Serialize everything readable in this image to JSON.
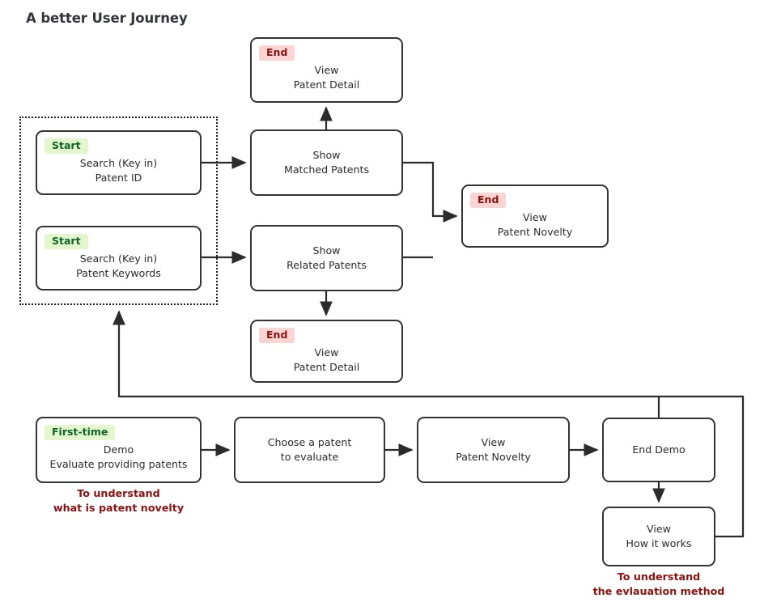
{
  "title": "A better User Journey",
  "colors": {
    "start_badge_bg": "#e4f7cc",
    "start_badge_text": "#10632c",
    "end_badge_bg": "#fbd4d4",
    "end_badge_text": "#8c1111",
    "node_border": "#333333",
    "caption_text": "#8c1111",
    "title_text": "#33353a",
    "edge": "#2b2b2b"
  },
  "badges": {
    "start": "Start",
    "end": "End",
    "first_time": "First-time"
  },
  "nodes": {
    "view_patent_detail_top": {
      "badge": "End",
      "label": "View\nPatent Detail"
    },
    "search_patent_id": {
      "badge": "Start",
      "label": "Search (Key in)\nPatent ID"
    },
    "search_patent_keywords": {
      "badge": "Start",
      "label": "Search (Key in)\nPatent Keywords"
    },
    "show_matched_patents": {
      "badge": "",
      "label": "Show\nMatched Patents"
    },
    "show_related_patents": {
      "badge": "",
      "label": "Show\nRelated Patents"
    },
    "view_patent_novelty_right": {
      "badge": "End",
      "label": "View\nPatent Novelty"
    },
    "view_patent_detail_bottom": {
      "badge": "End",
      "label": "View\nPatent Detail"
    },
    "demo_evaluate": {
      "badge": "First-time",
      "label": "Demo\nEvaluate providing patents"
    },
    "choose_a_patent": {
      "badge": "",
      "label": "Choose a patent\nto evaluate"
    },
    "view_patent_novelty_demo": {
      "badge": "",
      "label": "View\nPatent Novelty"
    },
    "end_demo": {
      "badge": "",
      "label": "End Demo"
    },
    "view_how_it_works": {
      "badge": "",
      "label": "View\nHow it works"
    }
  },
  "captions": {
    "understand_novelty": "To understand\nwhat is patent novelty",
    "understand_evaluation": "To understand\nthe evlauation method"
  }
}
